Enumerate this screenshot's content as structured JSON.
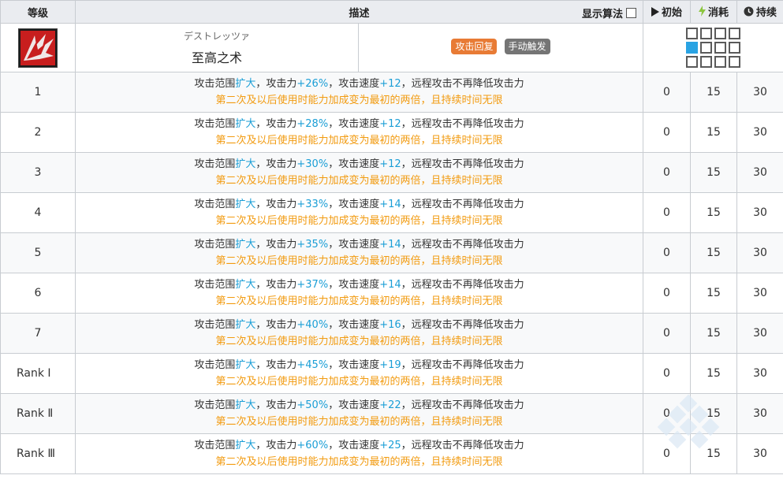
{
  "skill": {
    "name_jp": "デストレッツァ",
    "name_cn": "至高之术",
    "tags": [
      "攻击回复",
      "手动触发"
    ],
    "tag_colors": [
      "#e87b35",
      "#757575"
    ],
    "icon": "dragon-claw-skill-icon",
    "range_selected_cell": 5
  },
  "headers": {
    "level": "等级",
    "description": "描述",
    "show_formula": "显示算法",
    "initial": "初始",
    "cost": "消耗",
    "duration": "持续"
  },
  "desc_template": {
    "p1": "攻击范围",
    "p2": "扩大",
    "p3": "，攻击力",
    "p5": "，攻击速度",
    "p7": "，远程攻击不再降低攻击力",
    "line2": "第二次及以后使用时能力加成变为最初的两倍，且持续时间无限"
  },
  "rows": [
    {
      "level": "1",
      "atk": "+26%",
      "aspd": "+12",
      "initial": "0",
      "cost": "15",
      "duration": "30"
    },
    {
      "level": "2",
      "atk": "+28%",
      "aspd": "+12",
      "initial": "0",
      "cost": "15",
      "duration": "30"
    },
    {
      "level": "3",
      "atk": "+30%",
      "aspd": "+12",
      "initial": "0",
      "cost": "15",
      "duration": "30"
    },
    {
      "level": "4",
      "atk": "+33%",
      "aspd": "+14",
      "initial": "0",
      "cost": "15",
      "duration": "30"
    },
    {
      "level": "5",
      "atk": "+35%",
      "aspd": "+14",
      "initial": "0",
      "cost": "15",
      "duration": "30"
    },
    {
      "level": "6",
      "atk": "+37%",
      "aspd": "+14",
      "initial": "0",
      "cost": "15",
      "duration": "30"
    },
    {
      "level": "7",
      "atk": "+40%",
      "aspd": "+16",
      "initial": "0",
      "cost": "15",
      "duration": "30"
    },
    {
      "level": "Rank Ⅰ",
      "atk": "+45%",
      "aspd": "+19",
      "initial": "0",
      "cost": "15",
      "duration": "30"
    },
    {
      "level": "Rank Ⅱ",
      "atk": "+50%",
      "aspd": "+22",
      "initial": "0",
      "cost": "15",
      "duration": "30"
    },
    {
      "level": "Rank Ⅲ",
      "atk": "+60%",
      "aspd": "+25",
      "initial": "0",
      "cost": "15",
      "duration": "30"
    }
  ],
  "colors": {
    "accent_blue": "#1a9ed6",
    "accent_orange": "#f29b10",
    "header_bg": "#eaecf0"
  }
}
